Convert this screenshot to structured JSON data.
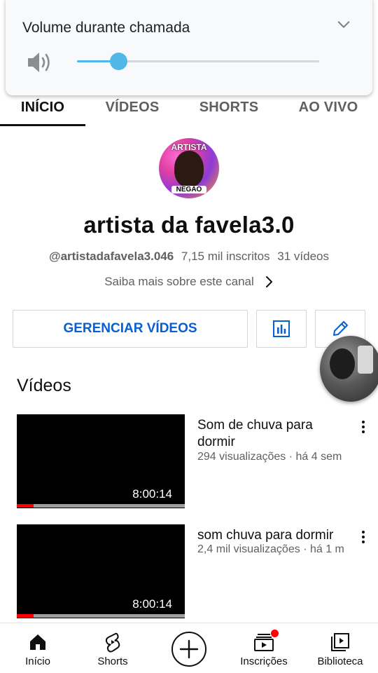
{
  "volume_panel": {
    "title": "Volume durante chamada",
    "level": 0.17,
    "accent_color": "#4fb8e6",
    "speaker_icon": "speaker-icon",
    "collapse_icon": "chevron-down-icon"
  },
  "tabs": [
    {
      "label": "INÍCIO",
      "active": true
    },
    {
      "label": "VÍDEOS",
      "active": false
    },
    {
      "label": "SHORTS",
      "active": false
    },
    {
      "label": "AO VIVO",
      "active": false
    }
  ],
  "channel": {
    "avatar_text_top": "ARTISTA",
    "avatar_text_bottom": "NEGÃO",
    "name": "artista da favela3.0",
    "handle": "@artistadafavela3.046",
    "subscribers": "7,15 mil inscritos",
    "video_count": "31 vídeos",
    "about_link": "Saiba mais sobre este canal"
  },
  "actions": {
    "manage_label": "GERENCIAR VÍDEOS",
    "manage_color": "#065fd4",
    "stats_icon": "bar-chart-icon",
    "edit_icon": "pencil-icon"
  },
  "section_title": "Vídeos",
  "videos": [
    {
      "title": "Som de chuva para dormir",
      "meta": "294 visualizações · há 4 sem",
      "duration": "8:00:14",
      "progress": 0.1
    },
    {
      "title": "som chuva para dormir",
      "meta": "2,4 mil visualizações · há 1 m",
      "duration": "8:00:14",
      "progress": 0.1
    }
  ],
  "bottom_nav": [
    {
      "label": "Início",
      "icon": "home-icon"
    },
    {
      "label": "Shorts",
      "icon": "shorts-icon"
    },
    {
      "label": "",
      "icon": "create-icon"
    },
    {
      "label": "Inscrições",
      "icon": "subscriptions-icon"
    },
    {
      "label": "Biblioteca",
      "icon": "library-icon"
    }
  ]
}
